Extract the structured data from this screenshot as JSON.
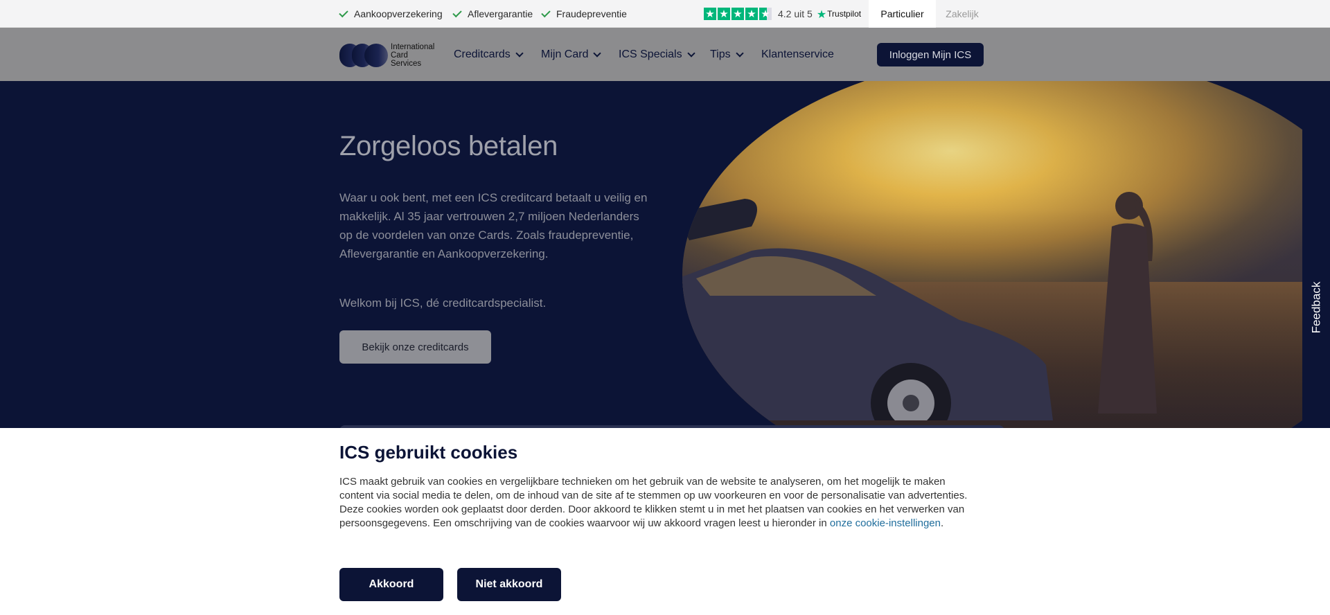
{
  "topbar": {
    "usps": [
      "Aankoopverzekering",
      "Aflevergarantie",
      "Fraudepreventie"
    ],
    "trustpilot": {
      "score_text": "4.2 uit 5",
      "brand": "Trustpilot",
      "rating": 4.2,
      "max": 5,
      "color": "#00b67a"
    },
    "segments": {
      "active": "Particulier",
      "inactive": "Zakelijk"
    }
  },
  "nav": {
    "logo_text": [
      "International",
      "Card",
      "Services"
    ],
    "items": [
      {
        "label": "Creditcards",
        "has_dropdown": true
      },
      {
        "label": "Mijn Card",
        "has_dropdown": true
      },
      {
        "label": "ICS Specials",
        "has_dropdown": true
      },
      {
        "label": "Tips",
        "has_dropdown": true
      },
      {
        "label": "Klantenservice",
        "has_dropdown": false
      }
    ],
    "login_label": "Inloggen Mijn ICS"
  },
  "hero": {
    "title": "Zorgeloos betalen",
    "body": "Waar u ook bent, met een ICS creditcard betaalt u veilig en makkelijk. Al 35 jaar vertrouwen 2,7 miljoen Nederlanders op de voordelen van onze Cards. Zoals fraudepreventie, Aflevergarantie en Aankoopverzekering.",
    "welcome": "Welkom bij ICS, dé creditcardspecialist.",
    "cta": "Bekijk onze creditcards"
  },
  "feedback": {
    "label": "Feedback"
  },
  "cookie": {
    "title": "ICS gebruikt cookies",
    "body": "ICS maakt gebruik van cookies en vergelijkbare technieken om het gebruik van de website te analyseren, om het mogelijk te maken content via social media te delen, om de inhoud van de site af te stemmen op uw voorkeuren en voor de personalisatie van advertenties. Deze cookies worden ook geplaatst door derden. Door akkoord te klikken stemt u in met het plaatsen van cookies en het verwerken van persoonsgegevens. Een omschrijving van de cookies waarvoor wij uw akkoord vragen leest u hieronder in ",
    "link": "onze cookie-instellingen",
    "body_end": ".",
    "accept": "Akkoord",
    "decline": "Niet akkoord"
  },
  "colors": {
    "brand_navy": "#0c1436",
    "link": "#1f6d9c",
    "check_green": "#2e9a4a"
  }
}
